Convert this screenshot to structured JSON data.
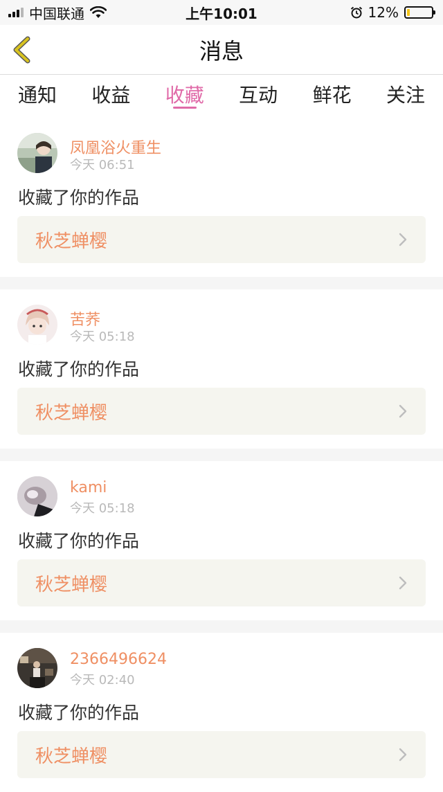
{
  "status_bar": {
    "carrier": "中国联通",
    "time": "上午10:01",
    "battery_percent": "12%",
    "battery_level": 0.12,
    "battery_color": "#f5c518"
  },
  "nav": {
    "title": "消息",
    "back_icon": "chevron-left-icon",
    "back_color": "#d8c321"
  },
  "tabs": [
    {
      "label": "通知",
      "active": false
    },
    {
      "label": "收益",
      "active": false
    },
    {
      "label": "收藏",
      "active": true
    },
    {
      "label": "互动",
      "active": false
    },
    {
      "label": "鲜花",
      "active": false
    },
    {
      "label": "关注",
      "active": false
    }
  ],
  "colors": {
    "accent_pink": "#e06aa8",
    "name_orange": "#ef8f63"
  },
  "notifications": [
    {
      "user": "凤凰浴火重生",
      "time": "今天 06:51",
      "action": "收藏了你的作品",
      "work": "秋芝蝉樱"
    },
    {
      "user": "苦荞",
      "time": "今天 05:18",
      "action": "收藏了你的作品",
      "work": "秋芝蝉樱"
    },
    {
      "user": "kami",
      "time": "今天 05:18",
      "action": "收藏了你的作品",
      "work": "秋芝蝉樱"
    },
    {
      "user": "2366496624",
      "time": "今天 02:40",
      "action": "收藏了你的作品",
      "work": "秋芝蝉樱"
    }
  ]
}
